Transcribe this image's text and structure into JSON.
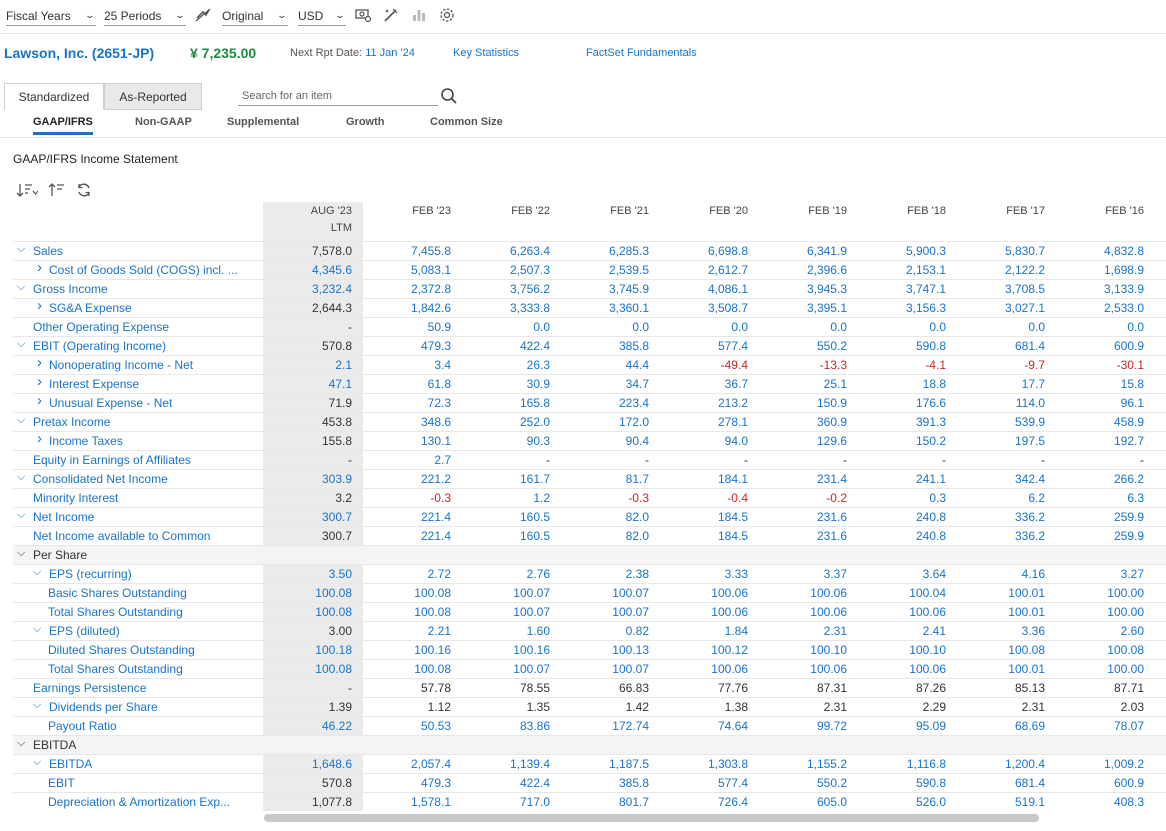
{
  "toolbar": {
    "period_type": "Fiscal Years",
    "periods": "25 Periods",
    "currency_mode": "Original",
    "currency": "USD"
  },
  "header": {
    "company": "Lawson, Inc. (2651-JP)",
    "price": "¥ 7,235.00",
    "next_rpt_label": "Next Rpt Date: ",
    "next_rpt_date": "11 Jan '24",
    "key_stats": "Key Statistics",
    "factset": "FactSet Fundamentals"
  },
  "tabs": {
    "standardized": "Standardized",
    "as_reported": "As-Reported",
    "search_placeholder": "Search for an item",
    "sub": [
      "GAAP/IFRS",
      "Non-GAAP",
      "Supplemental",
      "Growth",
      "Common Size"
    ]
  },
  "section_title": "GAAP/IFRS Income Statement",
  "columns": [
    {
      "line1": "AUG '23",
      "line2": "LTM"
    },
    {
      "line1": "FEB '23",
      "line2": ""
    },
    {
      "line1": "FEB '22",
      "line2": ""
    },
    {
      "line1": "FEB '21",
      "line2": ""
    },
    {
      "line1": "FEB '20",
      "line2": ""
    },
    {
      "line1": "FEB '19",
      "line2": ""
    },
    {
      "line1": "FEB '18",
      "line2": ""
    },
    {
      "line1": "FEB '17",
      "line2": ""
    },
    {
      "line1": "FEB '16",
      "line2": ""
    }
  ],
  "rows": [
    {
      "label": "Sales",
      "indent": 0,
      "toggle": "down",
      "dark": false,
      "values": [
        "7,578.0",
        "7,455.8",
        "6,263.4",
        "6,285.3",
        "6,698.8",
        "6,341.9",
        "5,900.3",
        "5,830.7",
        "4,832.8"
      ],
      "ltm_dark": true
    },
    {
      "label": "Cost of Goods Sold (COGS) incl. ...",
      "indent": 1,
      "toggle": "right",
      "dark": false,
      "values": [
        "4,345.6",
        "5,083.1",
        "2,507.3",
        "2,539.5",
        "2,612.7",
        "2,396.6",
        "2,153.1",
        "2,122.2",
        "1,698.9"
      ],
      "ltm_dark": false
    },
    {
      "label": "Gross Income",
      "indent": 0,
      "toggle": "down",
      "dark": false,
      "values": [
        "3,232.4",
        "2,372.8",
        "3,756.2",
        "3,745.9",
        "4,086.1",
        "3,945.3",
        "3,747.1",
        "3,708.5",
        "3,133.9"
      ],
      "ltm_dark": false
    },
    {
      "label": "SG&A Expense",
      "indent": 1,
      "toggle": "right",
      "dark": false,
      "values": [
        "2,644.3",
        "1,842.6",
        "3,333.8",
        "3,360.1",
        "3,508.7",
        "3,395.1",
        "3,156.3",
        "3,027.1",
        "2,533.0"
      ],
      "ltm_dark": true
    },
    {
      "label": "Other Operating Expense",
      "indent": 0,
      "toggle": "",
      "dark": false,
      "values": [
        "-",
        "50.9",
        "0.0",
        "0.0",
        "0.0",
        "0.0",
        "0.0",
        "0.0",
        "0.0"
      ],
      "ltm_dark": true
    },
    {
      "label": "EBIT (Operating Income)",
      "indent": 0,
      "toggle": "down",
      "dark": false,
      "values": [
        "570.8",
        "479.3",
        "422.4",
        "385.8",
        "577.4",
        "550.2",
        "590.8",
        "681.4",
        "600.9"
      ],
      "ltm_dark": true
    },
    {
      "label": "Nonoperating Income - Net",
      "indent": 1,
      "toggle": "right",
      "dark": false,
      "values": [
        "2.1",
        "3.4",
        "26.3",
        "44.4",
        "-49.4",
        "-13.3",
        "-4.1",
        "-9.7",
        "-30.1"
      ],
      "ltm_dark": false
    },
    {
      "label": "Interest Expense",
      "indent": 1,
      "toggle": "right",
      "dark": false,
      "values": [
        "47.1",
        "61.8",
        "30.9",
        "34.7",
        "36.7",
        "25.1",
        "18.8",
        "17.7",
        "15.8"
      ],
      "ltm_dark": false
    },
    {
      "label": "Unusual Expense - Net",
      "indent": 1,
      "toggle": "right",
      "dark": false,
      "values": [
        "71.9",
        "72.3",
        "165.8",
        "223.4",
        "213.2",
        "150.9",
        "176.6",
        "114.0",
        "96.1"
      ],
      "ltm_dark": true
    },
    {
      "label": "Pretax Income",
      "indent": 0,
      "toggle": "down",
      "dark": false,
      "values": [
        "453.8",
        "348.6",
        "252.0",
        "172.0",
        "278.1",
        "360.9",
        "391.3",
        "539.9",
        "458.9"
      ],
      "ltm_dark": true
    },
    {
      "label": "Income Taxes",
      "indent": 1,
      "toggle": "right",
      "dark": false,
      "values": [
        "155.8",
        "130.1",
        "90.3",
        "90.4",
        "94.0",
        "129.6",
        "150.2",
        "197.5",
        "192.7"
      ],
      "ltm_dark": true
    },
    {
      "label": "Equity in Earnings of Affiliates",
      "indent": 0,
      "toggle": "",
      "dark": false,
      "values": [
        "-",
        "2.7",
        "-",
        "-",
        "-",
        "-",
        "-",
        "-",
        "-"
      ],
      "ltm_dark": true
    },
    {
      "label": "Consolidated Net Income",
      "indent": 0,
      "toggle": "down",
      "dark": false,
      "values": [
        "303.9",
        "221.2",
        "161.7",
        "81.7",
        "184.1",
        "231.4",
        "241.1",
        "342.4",
        "266.2"
      ],
      "ltm_dark": false
    },
    {
      "label": "Minority Interest",
      "indent": 0,
      "toggle": "",
      "dark": false,
      "values": [
        "3.2",
        "-0.3",
        "1.2",
        "-0.3",
        "-0.4",
        "-0.2",
        "0.3",
        "6.2",
        "6.3"
      ],
      "ltm_dark": true
    },
    {
      "label": "Net Income",
      "indent": 0,
      "toggle": "down",
      "dark": false,
      "values": [
        "300.7",
        "221.4",
        "160.5",
        "82.0",
        "184.5",
        "231.6",
        "240.8",
        "336.2",
        "259.9"
      ],
      "ltm_dark": false
    },
    {
      "label": "Net Income available to Common",
      "indent": 0,
      "toggle": "",
      "dark": false,
      "values": [
        "300.7",
        "221.4",
        "160.5",
        "82.0",
        "184.5",
        "231.6",
        "240.8",
        "336.2",
        "259.9"
      ],
      "ltm_dark": true
    },
    {
      "label": "Per Share",
      "indent": 0,
      "toggle": "down",
      "dark": true,
      "group": true,
      "values": [
        "",
        "",
        "",
        "",
        "",
        "",
        "",
        "",
        ""
      ],
      "ltm_dark": true
    },
    {
      "label": "EPS (recurring)",
      "indent": 1,
      "toggle": "down",
      "dark": false,
      "values": [
        "3.50",
        "2.72",
        "2.76",
        "2.38",
        "3.33",
        "3.37",
        "3.64",
        "4.16",
        "3.27"
      ],
      "ltm_dark": false
    },
    {
      "label": "Basic Shares Outstanding",
      "indent": 2,
      "toggle": "",
      "dark": false,
      "values": [
        "100.08",
        "100.08",
        "100.07",
        "100.07",
        "100.06",
        "100.06",
        "100.04",
        "100.01",
        "100.00"
      ],
      "ltm_dark": false
    },
    {
      "label": "Total Shares Outstanding",
      "indent": 2,
      "toggle": "",
      "dark": false,
      "values": [
        "100.08",
        "100.08",
        "100.07",
        "100.07",
        "100.06",
        "100.06",
        "100.06",
        "100.01",
        "100.00"
      ],
      "ltm_dark": false
    },
    {
      "label": "EPS (diluted)",
      "indent": 1,
      "toggle": "down",
      "dark": false,
      "values": [
        "3.00",
        "2.21",
        "1.60",
        "0.82",
        "1.84",
        "2.31",
        "2.41",
        "3.36",
        "2.60"
      ],
      "ltm_dark": true
    },
    {
      "label": "Diluted Shares Outstanding",
      "indent": 2,
      "toggle": "",
      "dark": false,
      "values": [
        "100.18",
        "100.16",
        "100.16",
        "100.13",
        "100.12",
        "100.10",
        "100.10",
        "100.08",
        "100.08"
      ],
      "ltm_dark": false
    },
    {
      "label": "Total Shares Outstanding",
      "indent": 2,
      "toggle": "",
      "dark": false,
      "values": [
        "100.08",
        "100.08",
        "100.07",
        "100.07",
        "100.06",
        "100.06",
        "100.06",
        "100.01",
        "100.00"
      ],
      "ltm_dark": false
    },
    {
      "label": "Earnings Persistence",
      "indent": 0,
      "toggle": "",
      "dark": false,
      "values": [
        "-",
        "57.78",
        "78.55",
        "66.83",
        "77.76",
        "87.31",
        "87.26",
        "85.13",
        "87.71"
      ],
      "ltm_dark": true,
      "row_dark": true
    },
    {
      "label": "Dividends per Share",
      "indent": 1,
      "toggle": "down",
      "dark": false,
      "values": [
        "1.39",
        "1.12",
        "1.35",
        "1.42",
        "1.38",
        "2.31",
        "2.29",
        "2.31",
        "2.03"
      ],
      "ltm_dark": true,
      "row_dark": true
    },
    {
      "label": "Payout Ratio",
      "indent": 2,
      "toggle": "",
      "dark": false,
      "values": [
        "46.22",
        "50.53",
        "83.86",
        "172.74",
        "74.64",
        "99.72",
        "95.09",
        "68.69",
        "78.07"
      ],
      "ltm_dark": false
    },
    {
      "label": "EBITDA",
      "indent": 0,
      "toggle": "down",
      "dark": true,
      "group": true,
      "values": [
        "",
        "",
        "",
        "",
        "",
        "",
        "",
        "",
        ""
      ],
      "ltm_dark": true
    },
    {
      "label": "EBITDA",
      "indent": 1,
      "toggle": "down",
      "dark": false,
      "values": [
        "1,648.6",
        "2,057.4",
        "1,139.4",
        "1,187.5",
        "1,303.8",
        "1,155.2",
        "1,116.8",
        "1,200.4",
        "1,009.2"
      ],
      "ltm_dark": false
    },
    {
      "label": "EBIT",
      "indent": 2,
      "toggle": "",
      "dark": false,
      "values": [
        "570.8",
        "479.3",
        "422.4",
        "385.8",
        "577.4",
        "550.2",
        "590.8",
        "681.4",
        "600.9"
      ],
      "ltm_dark": true
    },
    {
      "label": "Depreciation & Amortization Exp...",
      "indent": 2,
      "toggle": "",
      "dark": false,
      "values": [
        "1,077.8",
        "1,578.1",
        "717.0",
        "801.7",
        "726.4",
        "605.0",
        "526.0",
        "519.1",
        "408.3"
      ],
      "ltm_dark": true
    }
  ]
}
